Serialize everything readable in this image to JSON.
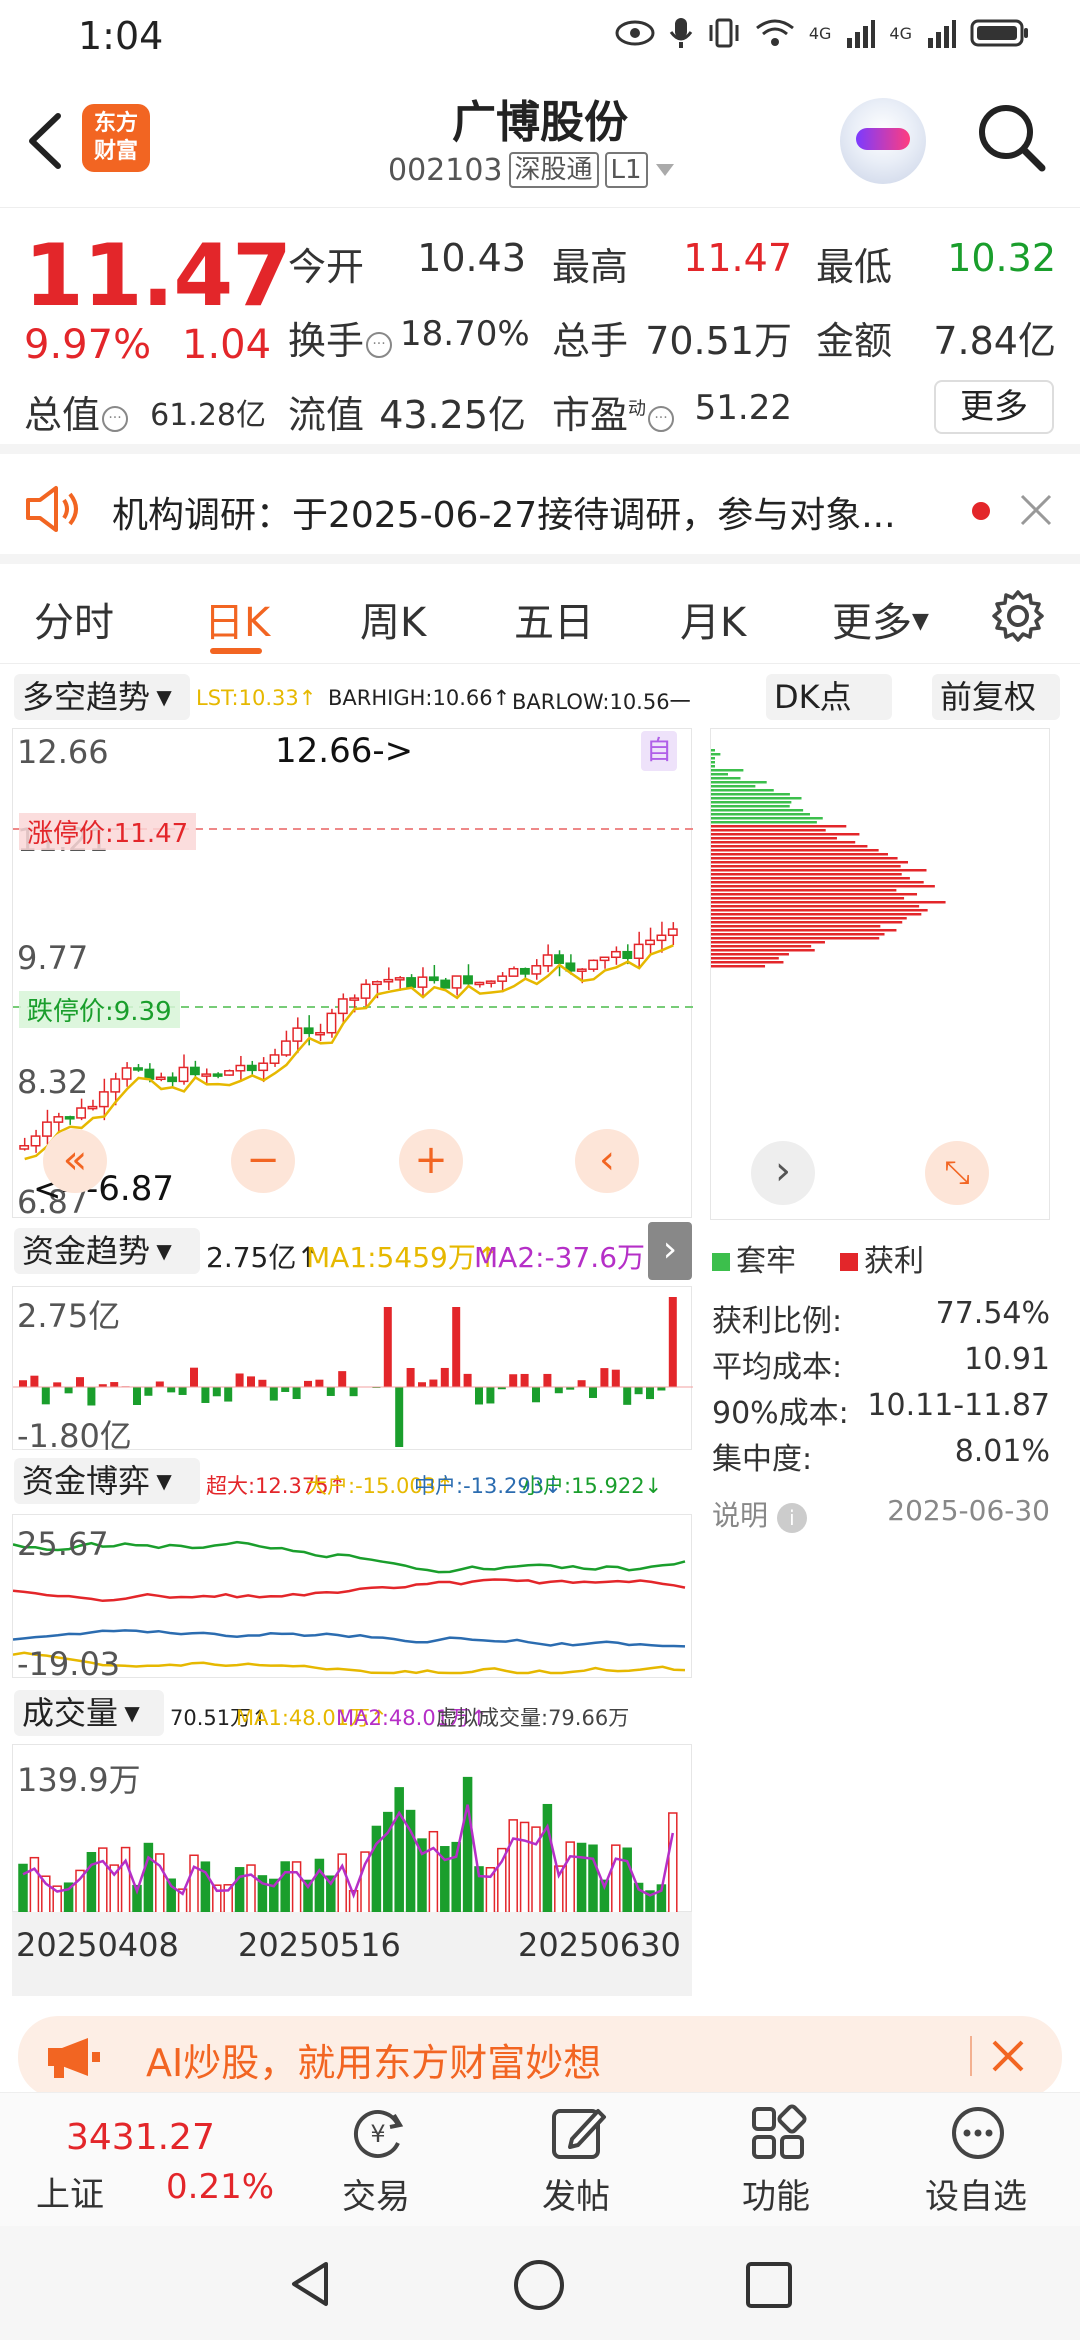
{
  "status": {
    "time": "1:04",
    "net1": "4G",
    "net2": "4G"
  },
  "header": {
    "logo_line1": "东方",
    "logo_line2": "财富",
    "name": "广博股份",
    "code": "002103",
    "tag1": "深股通",
    "tag2": "L1"
  },
  "quote": {
    "price": "11.47",
    "pct": "9.97%",
    "chg": "1.04",
    "open_label": "今开",
    "open": "10.43",
    "high_label": "最高",
    "high": "11.47",
    "low_label": "最低",
    "low": "10.32",
    "turnover_label": "换手",
    "turnover": "18.70%",
    "volume_label": "总手",
    "volume": "70.51万",
    "amount_label": "金额",
    "amount": "7.84亿",
    "mktcap_label": "总值",
    "mktcap": "61.28亿",
    "float_label": "流值",
    "float": "43.25亿",
    "pe_label": "市盈",
    "pe_sup": "动",
    "pe": "51.22",
    "more": "更多"
  },
  "notice": {
    "text": "机构调研：于2025-06-27接待调研，参与对象..."
  },
  "tabs": [
    "分时",
    "日K",
    "周K",
    "五日",
    "月K",
    "更多"
  ],
  "kline": {
    "indicator": "多空趋势",
    "lst": "LST:10.33↑",
    "barhigh": "BARHIGH:10.66↑",
    "barlow": "BARLOW:10.56一",
    "dk_button": "DK点",
    "adjust_button": "前复权",
    "y_top": "12.66",
    "y_mid1": "11.21",
    "y_mid2": "9.77",
    "y_mid3": "8.32",
    "y_bottom": "6.87",
    "limit_up": "涨停价:11.47",
    "limit_down": "跌停价:9.39",
    "high_marker": "12.66->",
    "low_marker": "<---6.87",
    "self_badge": "自"
  },
  "fund": {
    "indicator": "资金趋势",
    "value": "2.75亿↑",
    "ma1": "MA1:5459万↑",
    "ma2": "MA2:-37.6万↑",
    "y_top": "2.75亿",
    "y_bottom": "-1.80亿"
  },
  "game": {
    "indicator": "资金博弈",
    "super": "超大:12.375↑",
    "large": "大户:-15.003↑",
    "mid": "中户:-13.293↓",
    "small": "小户:15.922↓",
    "y_top": "25.67",
    "y_bottom": "-19.03"
  },
  "vol": {
    "indicator": "成交量",
    "value": "70.51万↑",
    "ma1": "MA1:48.01万↑",
    "ma2": "MA2:48.01万↑",
    "virtual": "虚拟成交量:79.66万",
    "y_top": "139.9万",
    "dates": [
      "20250408",
      "20250516",
      "20250630"
    ]
  },
  "chips": {
    "legend_trap": "套牢",
    "legend_profit": "获利",
    "rows": [
      {
        "label": "获利比例:",
        "value": "77.54%"
      },
      {
        "label": "平均成本:",
        "value": "10.91"
      },
      {
        "label": "90%成本:",
        "value": "10.11-11.87"
      },
      {
        "label": "集中度:",
        "value": "8.01%"
      }
    ],
    "note_label": "说明",
    "date": "2025-06-30"
  },
  "ad": {
    "text": "AI炒股，就用东方财富妙想"
  },
  "bottom": {
    "index_value": "3431.27",
    "index_name": "上证",
    "index_pct": "0.21%",
    "trade": "交易",
    "post": "发帖",
    "func": "功能",
    "watch": "设自选"
  },
  "colors": {
    "accent": "#f26522",
    "up": "#e3262a",
    "down": "#1a9e2c",
    "ma": "#e6b800"
  }
}
